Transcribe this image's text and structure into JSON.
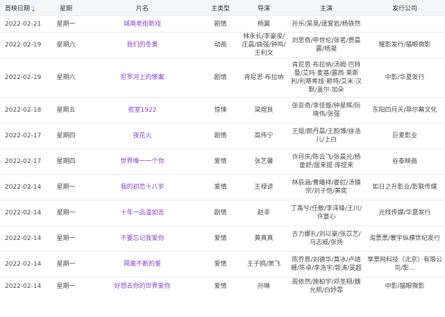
{
  "table": {
    "headers": {
      "date": "首映日期",
      "weekday": "星期",
      "title": "片名",
      "genre": "主类型",
      "director": "导演",
      "cast": "主演",
      "distributor": "发行公司"
    },
    "sort": {
      "column": "date",
      "direction": "desc",
      "accent": "#8e5fd6"
    },
    "link_color": "#8a3fd0",
    "rows": [
      {
        "date": "2022-02-21",
        "weekday": "星期一",
        "title": "城南老街新戏",
        "genre": "剧情",
        "director": "杨翼",
        "cast": "孙乐/吴昊/逯爱岩/杨轶然",
        "distributor": ""
      },
      {
        "date": "2022-02-19",
        "weekday": "星期六",
        "title": "我们的冬奥",
        "genre": "动画",
        "director": "林永长/李豪浚/庄晨/曲强/钟鸣/王利文",
        "cast": "刘思奇/申世伦/张茗/贾晨露/杨凝",
        "distributor": "耀影发行/猫眼微影"
      },
      {
        "date": "2022-02-19",
        "weekday": "星期六",
        "title": "尼罗河上的惨案",
        "genre": "剧情",
        "director": "肯尼思·布拉纳",
        "cast": "肯尼思·布拉纳/汤姆·巴特曼/艾玛·麦基/露西·莱斯利/利蒂希娅·赖特/艾米·汉默/盖尔·加朵",
        "distributor": "中影/华夏发行"
      },
      {
        "date": "2022-02-18",
        "weekday": "星期五",
        "title": "密室1922",
        "genre": "惊悚",
        "director": "梁煜良",
        "cast": "张亚奇/李佳璇/钟星辉/阮晓伟/张强",
        "distributor": "东阳四月天/菲尔幕文化"
      },
      {
        "date": "2022-02-17",
        "weekday": "星期四",
        "title": "夜花火",
        "genre": "剧情",
        "director": "高伟宁",
        "cast": "王挺/颜丹晨/王韵博/徐浩儿/上白",
        "distributor": "巨麦影业"
      },
      {
        "date": "2022-02-17",
        "weekday": "星期四",
        "title": "世界唯一一个你",
        "genre": "爱情",
        "director": "张艺馨",
        "cast": "许月庆/陈云飞/张晨光/杨童舒/居来提·库提来",
        "distributor": "谷泰映画"
      },
      {
        "date": "2022-02-14",
        "weekday": "星期一",
        "title": "我的初恋十八岁",
        "genre": "爱情",
        "director": "王禄谚",
        "cast": "林辰涵/曹曦祥/娄虹/汤镇宗/刘子恺/黄奕",
        "distributor": "如日之升影业/影联传媒"
      },
      {
        "date": "2022-02-14",
        "weekday": "星期一",
        "title": "十年一品温如言",
        "genre": "剧情",
        "director": "赵非",
        "cast": "丁禹兮/任敏/李泽锋/王川/许童心",
        "distributor": "光线传媒/华夏发行"
      },
      {
        "date": "2022-02-14",
        "weekday": "星期一",
        "title": "不要忘记我爱你",
        "genre": "爱情",
        "director": "黄真真",
        "cast": "古力娜扎/刘以豪/张苡艺/马志威/张扬",
        "distributor": "淘票票/寰宇纵横世纪发行"
      },
      {
        "date": "2022-02-14",
        "weekday": "星期一",
        "title": "隔离不断的爱",
        "genre": "爱情",
        "director": "王子鸥/萧飞",
        "cast": "陈乔恩/刘德华/莫冰/卢靖姗/陈卓/李浩宇/郭涛/吴超",
        "distributor": "享票网科技（北京）有限公司/影..."
      },
      {
        "date": "2022-02-14",
        "weekday": "星期一",
        "title": "好想去你的世界爱你",
        "genre": "爱情",
        "director": "孙琳",
        "cast": "周依然/施柏宇/邓圣翔/魏允熙/白妤霏",
        "distributor": "中影/猫眼微影"
      }
    ]
  }
}
